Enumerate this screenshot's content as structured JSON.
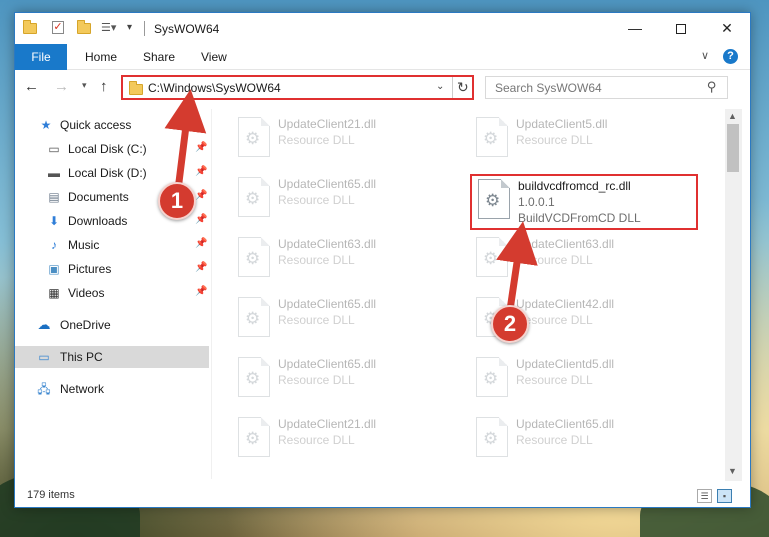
{
  "window": {
    "title": "SysWOW64",
    "min_glyph": "—",
    "close_glyph": "✕"
  },
  "ribbon": {
    "tabs": [
      "File",
      "Home",
      "Share",
      "View"
    ],
    "chevron": "∨",
    "help": "?"
  },
  "nav": {
    "address": "C:\\Windows\\SysWOW64",
    "search_placeholder": "Search SysWOW64"
  },
  "sidebar": {
    "items": [
      {
        "label": "Quick access",
        "icon": "star-icon",
        "pinned": false,
        "selected": false
      },
      {
        "label": "Local Disk (C:)",
        "icon": "drive-icon",
        "pinned": true,
        "selected": false
      },
      {
        "label": "Local Disk (D:)",
        "icon": "drive-icon",
        "pinned": true,
        "selected": false
      },
      {
        "label": "Documents",
        "icon": "documents-icon",
        "pinned": true,
        "selected": false
      },
      {
        "label": "Downloads",
        "icon": "download-icon",
        "pinned": true,
        "selected": false
      },
      {
        "label": "Music",
        "icon": "music-icon",
        "pinned": true,
        "selected": false
      },
      {
        "label": "Pictures",
        "icon": "pictures-icon",
        "pinned": true,
        "selected": false
      },
      {
        "label": "Videos",
        "icon": "videos-icon",
        "pinned": true,
        "selected": false
      },
      {
        "label": "OneDrive",
        "icon": "cloud-icon",
        "pinned": false,
        "selected": false
      },
      {
        "label": "This PC",
        "icon": "computer-icon",
        "pinned": false,
        "selected": true
      },
      {
        "label": "Network",
        "icon": "network-icon",
        "pinned": false,
        "selected": false
      }
    ]
  },
  "files": {
    "left_column": [
      {
        "name": "UpdateClient21.dll",
        "type": "Resource DLL"
      },
      {
        "name": "UpdateClient65.dll",
        "type": "Resource DLL"
      },
      {
        "name": "UpdateClient63.dll",
        "type": "Resource DLL"
      },
      {
        "name": "UpdateClient65.dll",
        "type": "Resource DLL"
      },
      {
        "name": "UpdateClient65.dll",
        "type": "Resource DLL"
      },
      {
        "name": "UpdateClient21.dll",
        "type": "Resource DLL"
      }
    ],
    "right_column": [
      {
        "name": "UpdateClient5.dll",
        "type": "Resource DLL"
      },
      {
        "name": "UpdateClient63.dll",
        "type": "Resource DLL"
      },
      {
        "name": "UpdateClient42.dll",
        "type": "Resource DLL"
      },
      {
        "name": "UpdateClientd5.dll",
        "type": "Resource DLL"
      },
      {
        "name": "UpdateClient65.dll",
        "type": "Resource DLL"
      }
    ],
    "highlighted": {
      "name": "buildvcdfromcd_rc.dll",
      "version": "1.0.0.1",
      "description": "BuildVCDFromCD DLL"
    }
  },
  "status": {
    "item_count": "179 items"
  },
  "annotations": {
    "step1": "1",
    "step2": "2",
    "color": "#d43b2f"
  }
}
